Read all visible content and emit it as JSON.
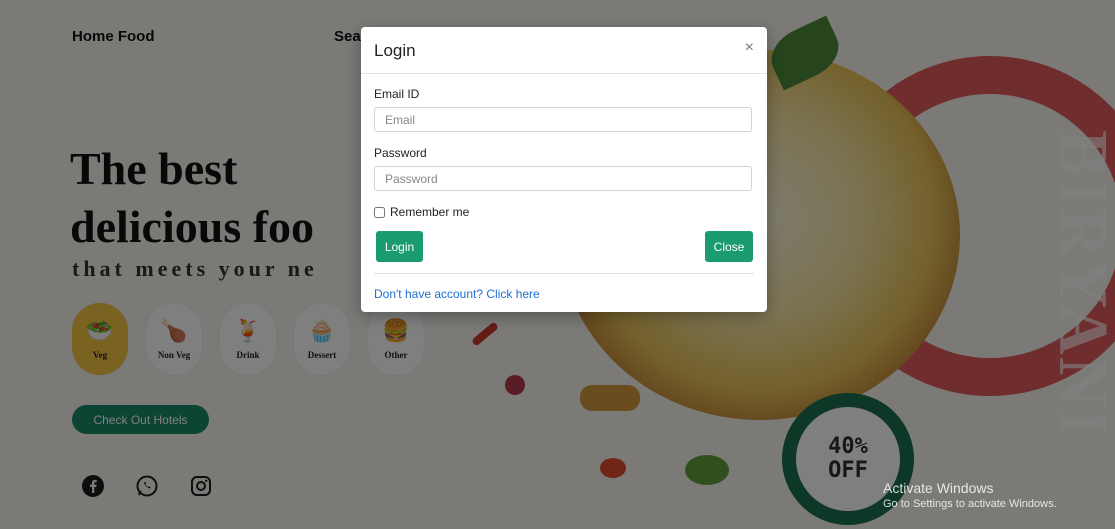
{
  "nav": {
    "home": "Home Food",
    "search": "Sea"
  },
  "hero": {
    "line1": "The best",
    "line2": "delicious foo",
    "subtitle": "that meets your ne"
  },
  "categories": [
    {
      "label": "Veg",
      "icon": "salad-icon",
      "active": true
    },
    {
      "label": "Non Veg",
      "icon": "chicken-leg-icon",
      "active": false
    },
    {
      "label": "Drink",
      "icon": "drink-icon",
      "active": false
    },
    {
      "label": "Dessert",
      "icon": "cupcake-icon",
      "active": false
    },
    {
      "label": "Other",
      "icon": "burger-icon",
      "active": false
    }
  ],
  "hotels_button": "Check Out Hotels",
  "social_icons": [
    "facebook-icon",
    "whatsapp-icon",
    "instagram-icon"
  ],
  "promo": {
    "vertical_text": "BIRYANI",
    "offer_line1": "40%",
    "offer_line2": "OFF"
  },
  "colors": {
    "accent": "#1a9c6e",
    "backdrop": "rgba(0,0,0,0.5)",
    "link": "#1e6fd1"
  },
  "modal": {
    "title": "Login",
    "close_icon": "×",
    "email_label": "Email ID",
    "email_placeholder": "Email",
    "email_value": "",
    "password_label": "Password",
    "password_placeholder": "Password",
    "password_value": "",
    "remember_label": "Remember me",
    "remember_checked": false,
    "login_button": "Login",
    "close_button": "Close",
    "signup_link": "Don't have account? Click here"
  },
  "windows_watermark": {
    "line1": "Activate Windows",
    "line2": "Go to Settings to activate Windows."
  }
}
